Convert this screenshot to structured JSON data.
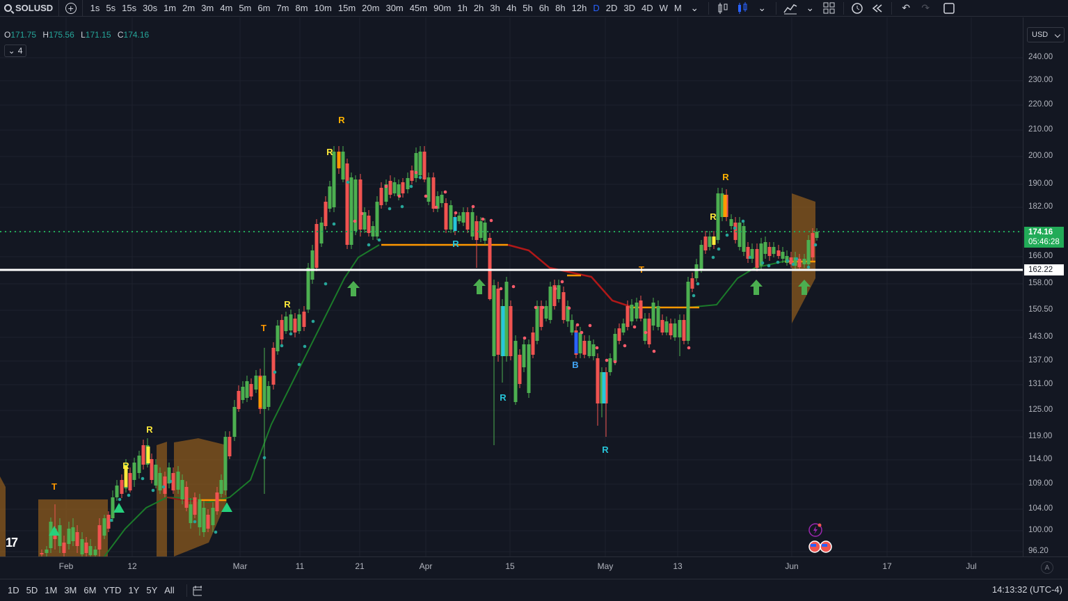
{
  "toolbar": {
    "symbol": "SOLUSD",
    "add_symbol": "+",
    "intervals": [
      "1s",
      "5s",
      "15s",
      "30s",
      "1m",
      "2m",
      "3m",
      "4m",
      "5m",
      "6m",
      "7m",
      "8m",
      "10m",
      "15m",
      "20m",
      "30m",
      "45m",
      "90m",
      "1h",
      "2h",
      "3h",
      "4h",
      "5h",
      "6h",
      "8h",
      "12h",
      "D",
      "2D",
      "3D",
      "4D",
      "W",
      "M"
    ],
    "active_interval": "D"
  },
  "legend": {
    "o_label": "O",
    "o_value": "171.75",
    "h_label": "H",
    "h_value": "175.56",
    "l_label": "L",
    "l_value": "171.15",
    "c_label": "C",
    "c_value": "174.16",
    "indicator_count": "4"
  },
  "price_axis": {
    "currency": "USD",
    "ticks": [
      "240.00",
      "230.00",
      "220.00",
      "210.00",
      "200.00",
      "190.00",
      "182.00",
      "174.00",
      "166.00",
      "158.00",
      "150.50",
      "143.00",
      "137.00",
      "131.00",
      "125.00",
      "119.00",
      "114.00",
      "109.00",
      "104.00",
      "100.00",
      "96.20"
    ],
    "current_price": "174.16",
    "countdown": "05:46:28",
    "line_price": "162.22"
  },
  "time_axis": {
    "ticks": [
      "Feb",
      "12",
      "Mar",
      "11",
      "21",
      "Apr",
      "15",
      "May",
      "13",
      "Jun",
      "17",
      "Jul"
    ],
    "auto_label": "A"
  },
  "bottom": {
    "ranges": [
      "1D",
      "5D",
      "1M",
      "3M",
      "6M",
      "YTD",
      "1Y",
      "5Y",
      "All"
    ],
    "clock": "14:13:32 (UTC-4)"
  },
  "signals": {
    "labels": [
      "R",
      "R",
      "R",
      "T",
      "R",
      "R",
      "T",
      "R",
      "R",
      "B",
      "R",
      "T",
      "R",
      "R"
    ]
  },
  "colors": {
    "background": "#131722",
    "up": "#4caf50",
    "down": "#f05350",
    "accent": "#2962ff",
    "current_price": "#22ab58",
    "line": "#ffffff"
  }
}
